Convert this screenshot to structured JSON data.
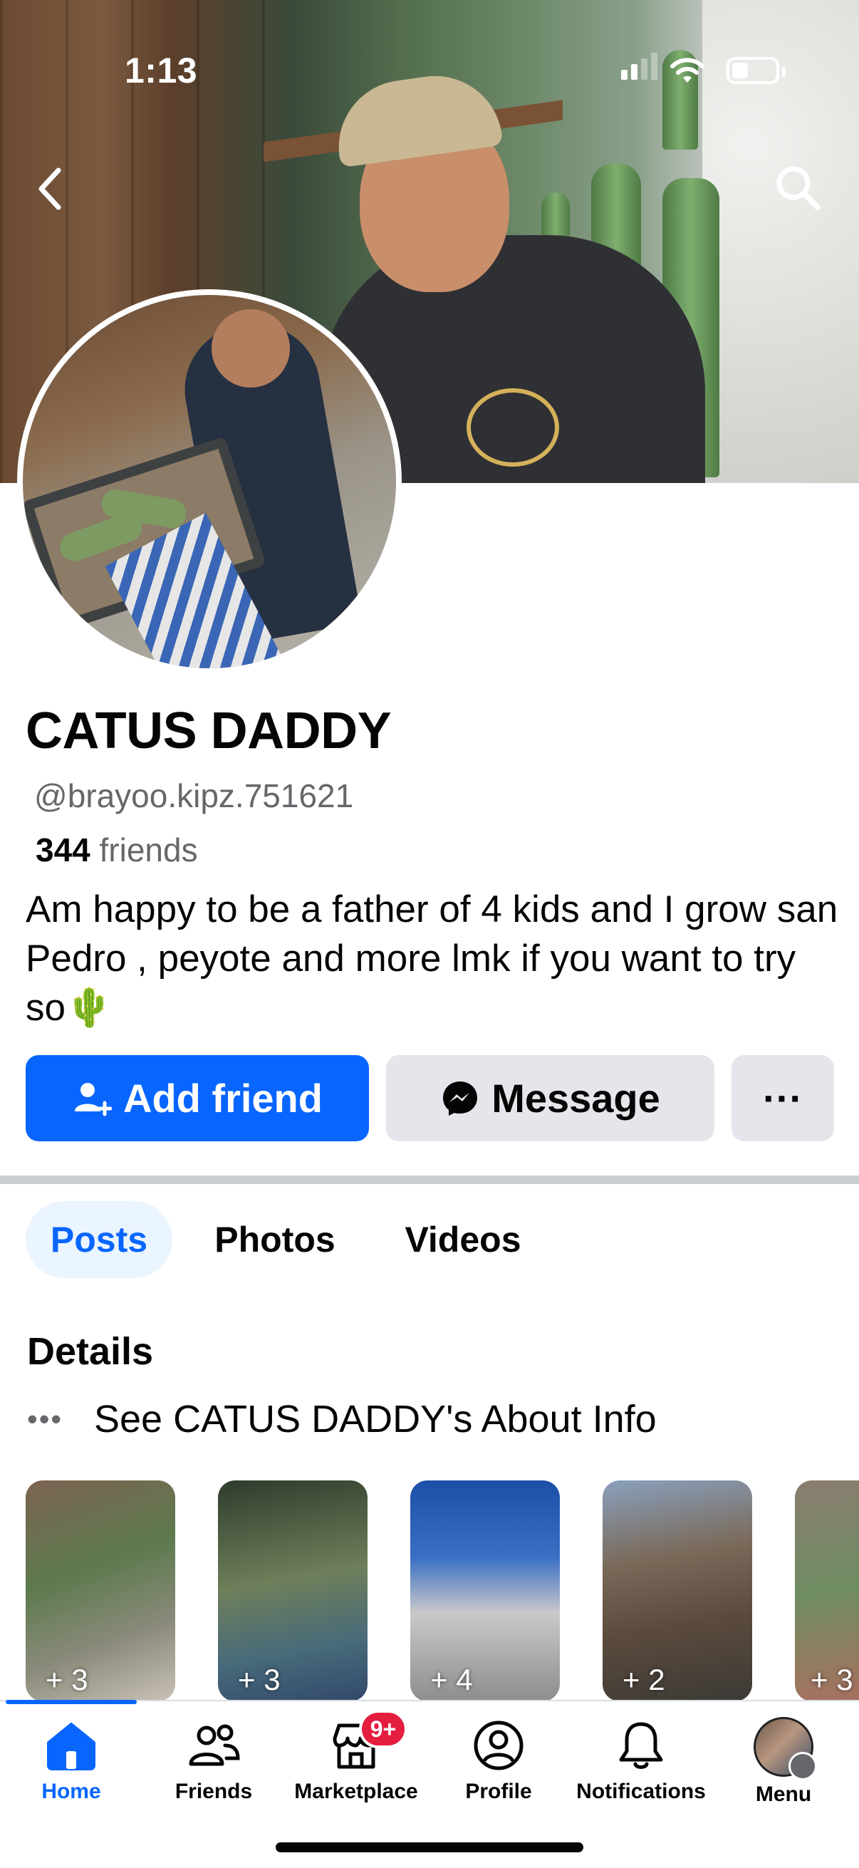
{
  "status_bar": {
    "time": "1:13"
  },
  "profile": {
    "name": "CATUS DADDY",
    "handle": "@brayoo.kipz.751621",
    "friends_count": "344",
    "friends_label": "friends",
    "bio": "Am happy to be a father of 4 kids and  I grow san Pedro , peyote and more lmk if you want to try so🌵"
  },
  "actions": {
    "add_friend": "Add friend",
    "message": "Message",
    "more": "···"
  },
  "tabs": [
    {
      "label": "Posts",
      "active": true
    },
    {
      "label": "Photos",
      "active": false
    },
    {
      "label": "Videos",
      "active": false
    }
  ],
  "details": {
    "title": "Details",
    "about_dots": "•••",
    "about_text": "See CATUS DADDY's About Info"
  },
  "highlights": [
    {
      "count": "+ 3"
    },
    {
      "count": "+ 3"
    },
    {
      "count": "+ 4"
    },
    {
      "count": "+ 2"
    },
    {
      "count": "+ 3"
    }
  ],
  "bottom_nav": [
    {
      "label": "Home",
      "icon": "home-icon",
      "active": true
    },
    {
      "label": "Friends",
      "icon": "friends-icon",
      "active": false
    },
    {
      "label": "Marketplace",
      "icon": "marketplace-icon",
      "active": false,
      "badge": "9+"
    },
    {
      "label": "Profile",
      "icon": "profile-icon",
      "active": false
    },
    {
      "label": "Notifications",
      "icon": "bell-icon",
      "active": false
    },
    {
      "label": "Menu",
      "icon": "menu-avatar",
      "active": false
    }
  ],
  "colors": {
    "accent": "#0866ff",
    "badge": "#e41e3f",
    "secondary_text": "#65676b",
    "button_gray": "#e4e6eb"
  }
}
